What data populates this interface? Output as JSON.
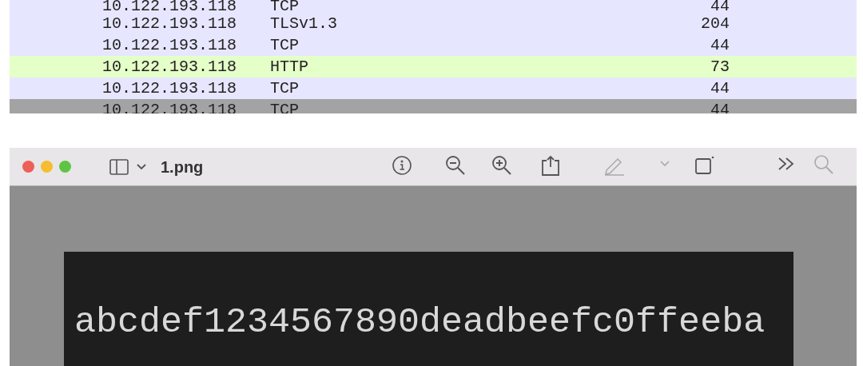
{
  "packet_list": {
    "rows": [
      {
        "source": "10.122.193.118",
        "protocol": "TCP",
        "length": "44",
        "color": "#e7e6ff",
        "selected": false
      },
      {
        "source": "10.122.193.118",
        "protocol": "TLSv1.3",
        "length": "204",
        "color": "#e7e6ff",
        "selected": false
      },
      {
        "source": "10.122.193.118",
        "protocol": "TCP",
        "length": "44",
        "color": "#e7e6ff",
        "selected": false
      },
      {
        "source": "10.122.193.118",
        "protocol": "HTTP",
        "length": "73",
        "color": "#e4ffc7",
        "selected": false
      },
      {
        "source": "10.122.193.118",
        "protocol": "TCP",
        "length": "44",
        "color": "#e7e6ff",
        "selected": false
      },
      {
        "source": "10.122.193.118",
        "protocol": "TCP",
        "length": "44",
        "selected": true
      }
    ]
  },
  "preview_window": {
    "title": "1.png",
    "image_text": "abcdef1234567890deadbeefc0ffeeba"
  }
}
